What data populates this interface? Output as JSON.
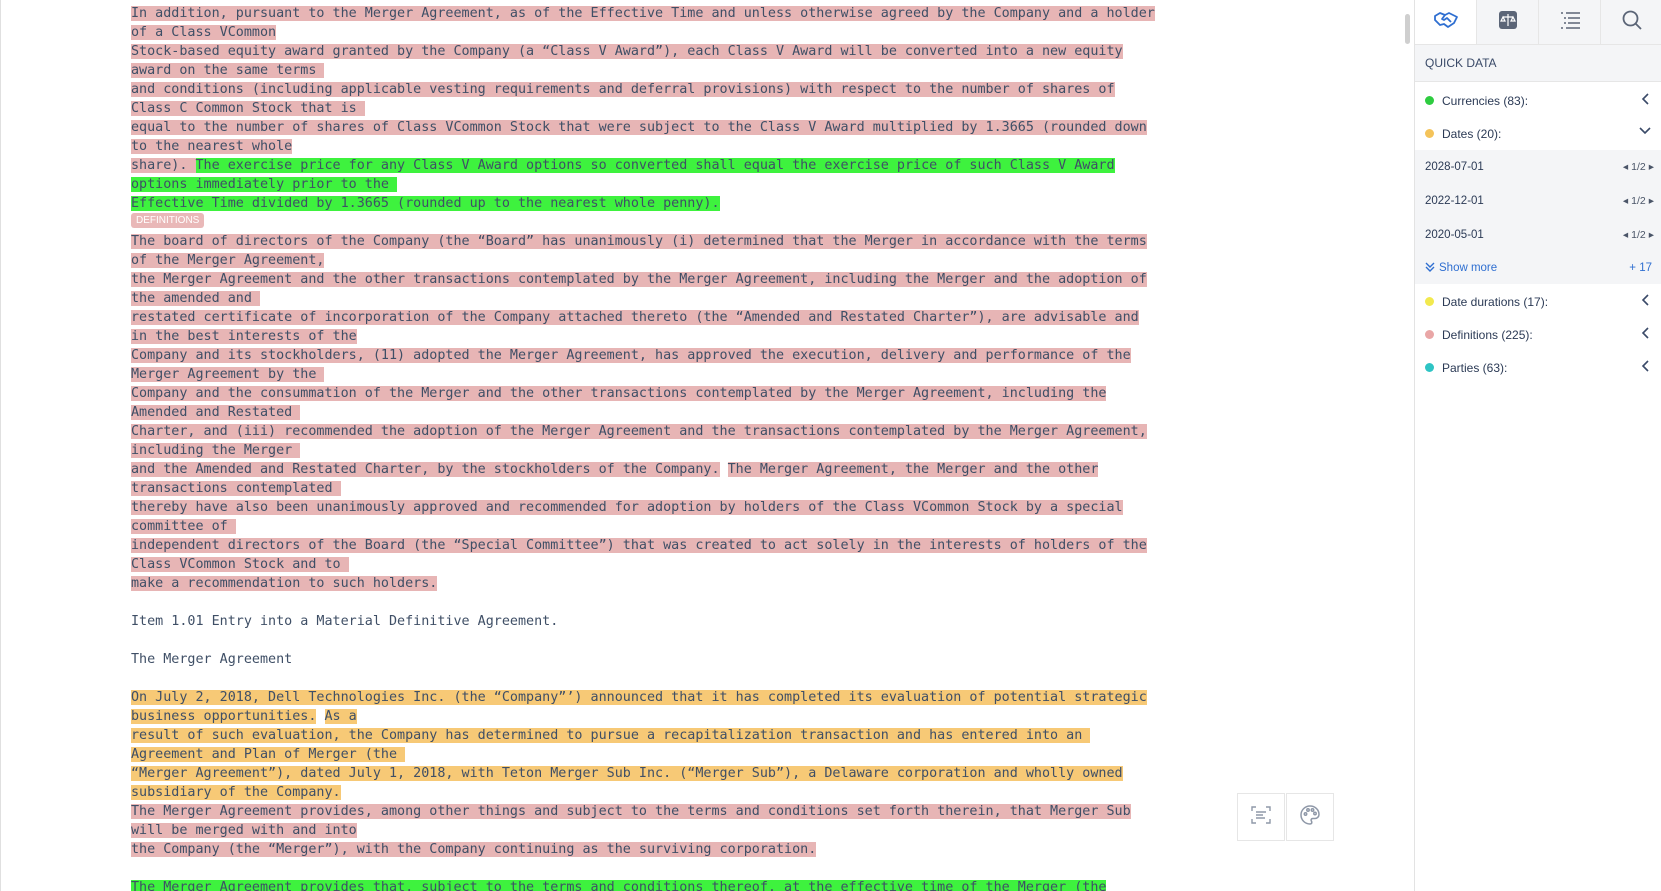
{
  "document": {
    "definitions_tag": "DEFINITIONS",
    "block1": [
      [
        [
          "pink",
          "In addition, pursuant to the Merger Agreement, as of the Effective Time and unless otherwise agreed by the Company and a holder"
        ]
      ],
      [
        [
          "pink",
          "of a Class VCommon"
        ]
      ],
      [
        [
          "pink",
          "Stock-based equity award granted by the Company (a “Class V Award”), each Class V Award will be converted into a new equity"
        ]
      ],
      [
        [
          "pink",
          "award on the same terms "
        ]
      ],
      [
        [
          "pink",
          "and conditions (including applicable vesting requirements and deferral provisions) with respect to the number of shares of"
        ]
      ],
      [
        [
          "pink",
          "Class C Common Stock that is "
        ]
      ],
      [
        [
          "pink",
          "equal to the number of shares of Class VCommon Stock that were subject to the Class V Award multiplied by 1.3665 (rounded down"
        ]
      ],
      [
        [
          "pink",
          "to the nearest whole"
        ]
      ],
      [
        [
          "pink",
          "share). "
        ],
        [
          "green",
          "The exercise price for any Class V Award options so converted shall equal the exercise price of such Class V Award"
        ]
      ],
      [
        [
          "green",
          "options immediately prior to the "
        ]
      ],
      [
        [
          "green",
          "Effective Time divided by 1.3665 (rounded up to the nearest whole penny)."
        ]
      ]
    ],
    "block2": [
      [
        [
          "pink",
          "The board of directors of the Company (the “Board” has unanimously (i) determined that the Merger in accordance with the terms"
        ]
      ],
      [
        [
          "pink",
          "of the Merger Agreement,"
        ]
      ],
      [
        [
          "pink",
          "the Merger Agreement and the other transactions contemplated by the Merger Agreement, including the Merger and the adoption of"
        ]
      ],
      [
        [
          "pink",
          "the amended and "
        ]
      ],
      [
        [
          "pink",
          "restated certificate of incorporation of the Company attached thereto (the “Amended and Restated Charter”), are advisable and"
        ]
      ],
      [
        [
          "pink",
          "in the best interests of the"
        ]
      ],
      [
        [
          "pink",
          "Company and its stockholders, (11) adopted the Merger Agreement, has approved the execution, delivery and performance of the"
        ]
      ],
      [
        [
          "pink",
          "Merger Agreement by the "
        ]
      ],
      [
        [
          "pink",
          "Company and the consummation of the Merger and the other transactions contemplated by the Merger Agreement, including the"
        ]
      ],
      [
        [
          "pink",
          "Amended and Restated "
        ]
      ],
      [
        [
          "pink",
          "Charter, and (iii) recommended the adoption of the Merger Agreement and the transactions contemplated by the Merger Agreement,"
        ]
      ],
      [
        [
          "pink",
          "including the Merger "
        ]
      ],
      [
        [
          "pink",
          "and the Amended and Restated Charter, by the stockholders of the Company."
        ],
        [
          "plain",
          " "
        ],
        [
          "pink",
          "The Merger Agreement, the Merger and the other"
        ]
      ],
      [
        [
          "pink",
          "transactions contemplated "
        ]
      ],
      [
        [
          "pink",
          "thereby have also been unanimously approved and recommended for adoption by holders of the Class VCommon Stock by a special"
        ]
      ],
      [
        [
          "pink",
          "committee of "
        ]
      ],
      [
        [
          "pink",
          "independent directors of the Board (the “Special Committee”) that was created to act solely in the interests of holders of the"
        ]
      ],
      [
        [
          "pink",
          "Class VCommon Stock and to "
        ]
      ],
      [
        [
          "pink",
          "make a recommendation to such holders."
        ]
      ]
    ],
    "item_heading": "Item 1.01 Entry into a Material Definitive Agreement.",
    "merger_heading": "The Merger Agreement",
    "block3": [
      [
        [
          "orange",
          "On July 2, 2018, Dell Technologies Inc. (the “Company”’) announced that it has completed its evaluation of potential strategic"
        ]
      ],
      [
        [
          "orange",
          "business opportunities."
        ],
        [
          "plain",
          " "
        ],
        [
          "orange",
          "As a"
        ]
      ],
      [
        [
          "orange",
          "result of such evaluation, the Company has determined to pursue a recapitalization transaction and has entered into an "
        ]
      ],
      [
        [
          "orange",
          "Agreement and Plan of Merger (the "
        ]
      ],
      [
        [
          "orange",
          "“Merger Agreement”), dated July 1, 2018, with Teton Merger Sub Inc. (“Merger Sub”), a Delaware corporation and wholly owned"
        ]
      ],
      [
        [
          "orange",
          "subsidiary of the Company."
        ]
      ],
      [
        [
          "pink",
          "The Merger Agreement provides, among other things and subject to the terms and conditions set forth therein, that Merger Sub"
        ]
      ],
      [
        [
          "pink",
          "will be merged with and into"
        ]
      ],
      [
        [
          "pink",
          "the Company (the “Merger”), with the Company continuing as the surviving corporation."
        ]
      ]
    ],
    "block4": [
      [
        [
          "green",
          "The Merger Agreement provides that, subject to the terms and conditions thereof, at the effective time of the Merger (the"
        ]
      ]
    ]
  },
  "panel": {
    "tabs": [
      "handshake-icon",
      "scale-icon",
      "list-icon",
      "search-icon"
    ],
    "title": "QUICK DATA",
    "categories": {
      "currencies": {
        "label": "Currencies (83):",
        "color": "#2ecc40"
      },
      "dates": {
        "label": "Dates (20):",
        "color": "#f4c35a"
      },
      "date_durations": {
        "label": "Date durations (17):",
        "color": "#f2e94e"
      },
      "definitions": {
        "label": "Definitions (225):",
        "color": "#e9a6a6"
      },
      "parties": {
        "label": "Parties (63):",
        "color": "#2ec4c4"
      }
    },
    "dates": [
      {
        "value": "2028-07-01",
        "pager": "1/2"
      },
      {
        "value": "2022-12-01",
        "pager": "1/2"
      },
      {
        "value": "2020-05-01",
        "pager": "1/2"
      }
    ],
    "show_more": "Show more",
    "more_count": "+ 17"
  }
}
